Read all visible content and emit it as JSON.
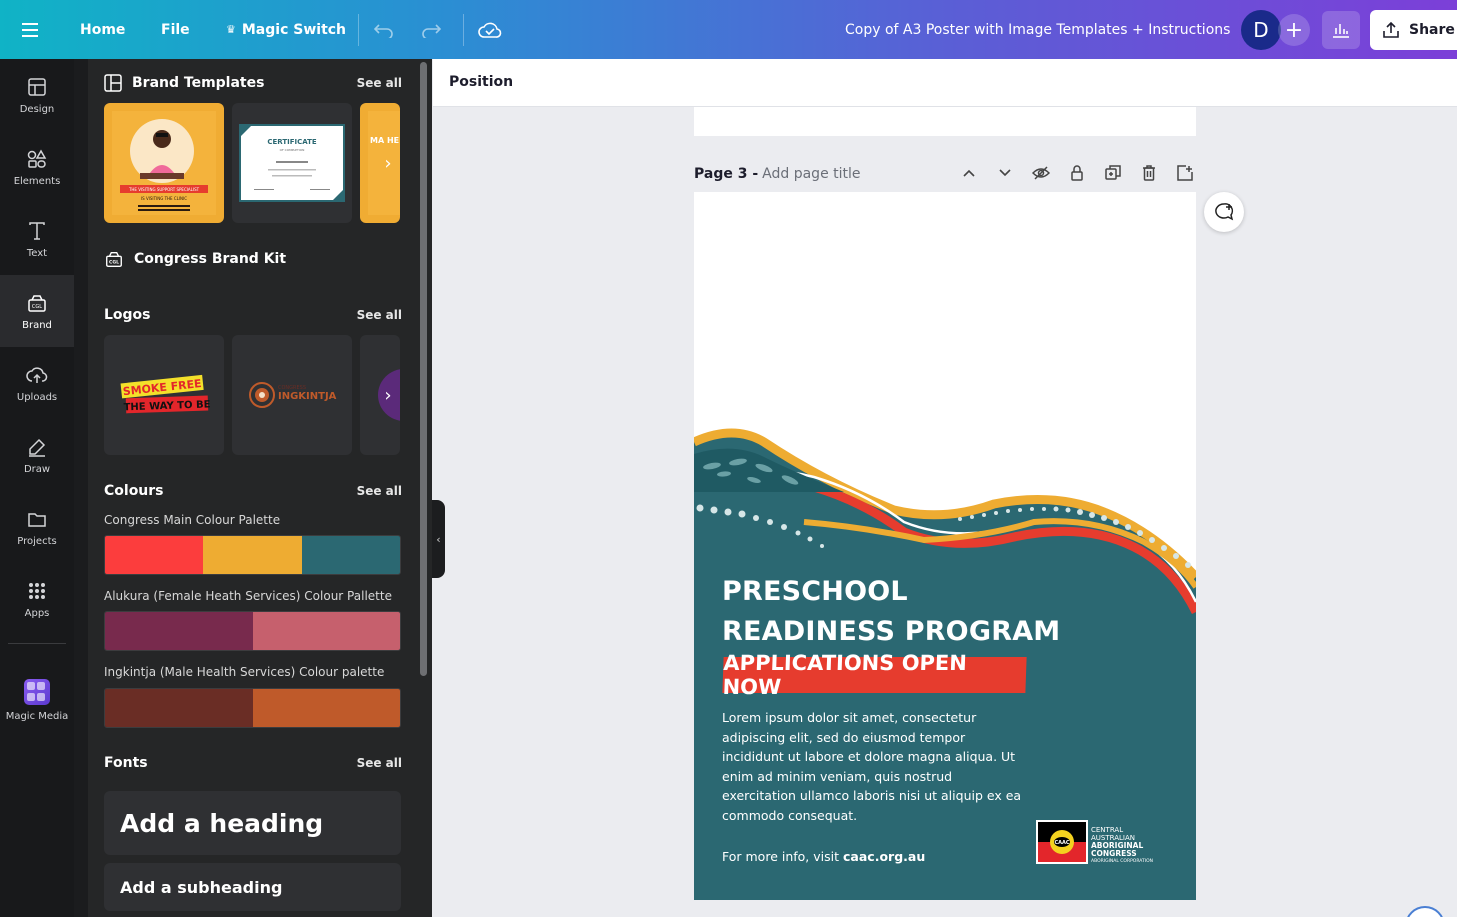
{
  "topbar": {
    "home": "Home",
    "file": "File",
    "magic_switch": "Magic Switch",
    "doc_title": "Copy of A3 Poster with Image Templates + Instructions",
    "avatar_letter": "D",
    "share": "Share"
  },
  "rail": {
    "items": [
      {
        "label": "Design",
        "icon": "design-icon"
      },
      {
        "label": "Elements",
        "icon": "elements-icon"
      },
      {
        "label": "Text",
        "icon": "text-icon"
      },
      {
        "label": "Brand",
        "icon": "brand-icon",
        "active": true
      },
      {
        "label": "Uploads",
        "icon": "uploads-icon"
      },
      {
        "label": "Draw",
        "icon": "draw-icon"
      },
      {
        "label": "Projects",
        "icon": "folder-icon"
      },
      {
        "label": "Apps",
        "icon": "apps-icon"
      },
      {
        "label": "Magic Media",
        "icon": "magic-media-icon"
      }
    ]
  },
  "panel": {
    "brand_templates": {
      "title": "Brand Templates",
      "see_all": "See all"
    },
    "template_thumbs": {
      "t1_line1": "THE VISITING SUPPORT SPECIALIST",
      "t1_line2": "IS VISITING THE CLINIC",
      "t2_title": "CERTIFICATE",
      "t2_sub": "OF COMPLETION",
      "t3_text": "MA HE"
    },
    "brand_kit": {
      "title": "Congress Brand Kit"
    },
    "logos": {
      "title": "Logos",
      "see_all": "See all",
      "logo1_line1": "SMOKE FREE",
      "logo1_line2": "THE WAY TO BE",
      "logo2_small": "CONGRESS",
      "logo2_big": "INGKINTJA"
    },
    "colours": {
      "title": "Colours",
      "see_all": "See all",
      "palettes": [
        {
          "name": "Congress Main Colour Palette",
          "colors": [
            "#fc3d3d",
            "#eeac32",
            "#2b6872"
          ]
        },
        {
          "name": "Alukura (Female Heath Services) Colour Pallette",
          "colors": [
            "#782a4d",
            "#c6606d"
          ]
        },
        {
          "name": "Ingkintja (Male Health Services) Colour palette",
          "colors": [
            "#6a2d25",
            "#bf5a2a"
          ]
        }
      ]
    },
    "fonts": {
      "title": "Fonts",
      "see_all": "See all",
      "heading": "Add a heading",
      "subheading": "Add a subheading"
    }
  },
  "canvas": {
    "toolbar_position": "Position",
    "page_label": "Page 3 -",
    "page_title_placeholder": "Add page title"
  },
  "poster": {
    "title_line1": "PRESCHOOL",
    "title_line2": "READINESS PROGRAM",
    "badge": "APPLICATIONS OPEN NOW",
    "body": "Lorem ipsum dolor sit amet, consectetur adipiscing elit, sed do eiusmod tempor incididunt ut labore et dolore magna aliqua. Ut enim ad minim veniam, quis nostrud exercitation ullamco laboris nisi ut aliquip ex ea commodo consequat.",
    "info_prefix": "For more info, visit",
    "info_link": "caac.org.au",
    "logo_lines": [
      "CENTRAL",
      "AUSTRALIAN",
      "ABORIGINAL",
      "CONGRESS",
      "ABORIGINAL CORPORATION"
    ],
    "logo_badge": "CAAC",
    "colors": {
      "teal": "#2b6872",
      "yellow": "#eeac32",
      "red": "#e63c2e"
    }
  }
}
